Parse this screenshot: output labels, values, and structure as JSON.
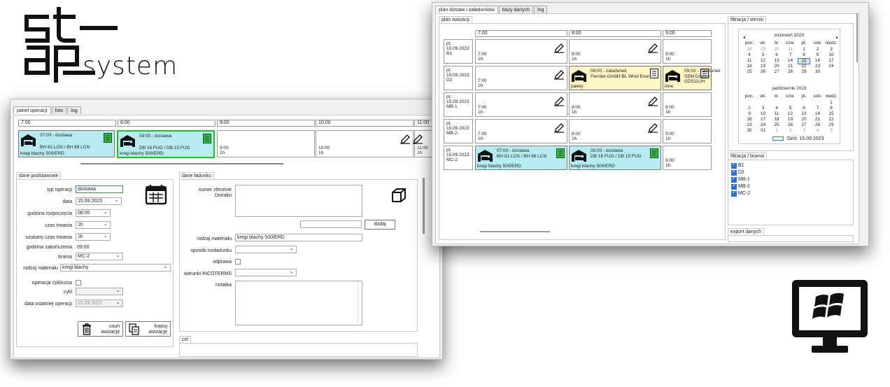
{
  "logo": {
    "text": "stapsystem"
  },
  "left": {
    "tabs": [
      "panel operacji",
      "foto",
      "log"
    ],
    "time_headers": [
      "7:00",
      "8:00",
      "9:00",
      "10:00",
      "11:00"
    ],
    "events": [
      {
        "line1": "07:00 - dostawa",
        "line2": "BH 81 LCN / BH 88 LCN",
        "line3": "kregi blachy 500/ERD"
      },
      {
        "line1": "08:00 - dostawa",
        "line2": "DB 16 FUG / DB 15 FUG",
        "line3": "kregi blachy 500/ERD"
      }
    ],
    "free_slots": [
      {
        "time": "9:00",
        "dur": "1h"
      },
      {
        "time": "10:00",
        "dur": "1h"
      },
      {
        "time": "11:00",
        "dur": "1h"
      }
    ],
    "basic": {
      "title": "dane podstawowe",
      "typ_label": "typ operacji",
      "typ_value": "dostawa",
      "data_label": "data",
      "data_value": "15.09.2023",
      "start_label": "godzina rozpoczęcia",
      "start_value": "08:00",
      "czas_label": "czas trwania",
      "czas_value": "1h",
      "szukany_label": "szukany czas trwania",
      "szukany_value": "1h",
      "end_label": "godzina zakończenia",
      "end_value": "09:00",
      "brama_label": "brama",
      "brama_value": "MC-2",
      "material_label": "rodzaj materiału",
      "material_value": "kregi blachy",
      "cykl_op_label": "operacja cykliczna",
      "cykl_label": "cykl",
      "last_label": "data ostatniej operacji",
      "last_value": "15.09.2023",
      "delete_label_1": "usuń",
      "delete_label_2": "awizację",
      "copy_label_1": "kopiuj",
      "copy_label_2": "awizację"
    },
    "cargo": {
      "title": "dane ładunku",
      "order_label_1": "numer zlecenie",
      "order_label_2": "Donako",
      "add_label": "dodaj",
      "material_label": "rodzaj materiału",
      "material_value": "kregi blachy 500/ERD",
      "unload_label": "sposób rozładunku",
      "odprawa_label": "odprawa",
      "incoterms_label": "warunki INCOTERMS",
      "note_label": "notatka",
      "cel_label": "cel"
    }
  },
  "right": {
    "tabs": [
      "plan dostaw i załadunków",
      "bazy danych",
      "log"
    ],
    "plan_title": "plan awizacji",
    "time_headers": [
      "7:00",
      "8:00",
      "9:00"
    ],
    "rows": [
      {
        "day": "pt.",
        "date": "15.09.2023",
        "gate": "B1"
      },
      {
        "day": "pt.",
        "date": "15.09.2023",
        "gate": "D2"
      },
      {
        "day": "pt.",
        "date": "15.09.2023",
        "gate": "MB-1"
      },
      {
        "day": "pt.",
        "date": "15.09.2023",
        "gate": "MB-2"
      },
      {
        "day": "pt.",
        "date": "15.09.2023",
        "gate": "MC-2"
      }
    ],
    "slot_dur": "1h",
    "ev_d2_1": {
      "line1": "08:00 - załadunek",
      "line2": "Flender GmbH BL Wind Ener",
      "line3": "palety"
    },
    "ev_d2_2": {
      "line1": "09:00 - załadunek",
      "line2": "SEM Drasov",
      "line2b": "GD511UH",
      "line3": "inne"
    },
    "ev_mc_1": {
      "line1": "07:00 - dostawa",
      "line2": "BH 81 LCN / BH 88 LCN",
      "line3": "kregi blachy 500/ERD"
    },
    "ev_mc_2": {
      "line1": "08:00 - dostawa",
      "line2": "DB 16 FUG / DB 15 FUG",
      "line3": "kregi blachy 500/ERD"
    },
    "filter_date_title": "filtracja / termin",
    "cal1_title": "wrzesień 2023",
    "cal2_title": "październik 2023",
    "weekdays": [
      "pon.",
      "wt.",
      "śr.",
      "czw.",
      "pt.",
      "sob.",
      "niedz."
    ],
    "cal1": [
      [
        "28",
        "29",
        "30",
        "31",
        "1",
        "2",
        "3"
      ],
      [
        "4",
        "5",
        "6",
        "7",
        "8",
        "9",
        "10"
      ],
      [
        "11",
        "12",
        "13",
        "14",
        "15",
        "16",
        "17"
      ],
      [
        "18",
        "19",
        "20",
        "21",
        "22",
        "23",
        "24"
      ],
      [
        "25",
        "26",
        "27",
        "28",
        "29",
        "30",
        ""
      ]
    ],
    "cal2": [
      [
        "",
        "",
        "",
        "",
        "",
        "",
        "1"
      ],
      [
        "2",
        "3",
        "4",
        "5",
        "6",
        "7",
        "8"
      ],
      [
        "9",
        "10",
        "11",
        "12",
        "13",
        "14",
        "15"
      ],
      [
        "16",
        "17",
        "18",
        "19",
        "20",
        "21",
        "22"
      ],
      [
        "23",
        "24",
        "25",
        "26",
        "27",
        "28",
        "29"
      ],
      [
        "30",
        "31",
        "1",
        "2",
        "3",
        "4",
        "5"
      ]
    ],
    "today_label": "Dziś: 15.09.2023",
    "filter_gate_title": "filtracja / brama",
    "gates": [
      "B1",
      "D2",
      "MB-1",
      "MB-2",
      "MC-2"
    ],
    "export_title": "export danych"
  },
  "colors": {
    "cyan": "#b6ebef",
    "yellow": "#fff4c4",
    "selected": "#2db92d",
    "checkbox": "#2a6fd6"
  }
}
